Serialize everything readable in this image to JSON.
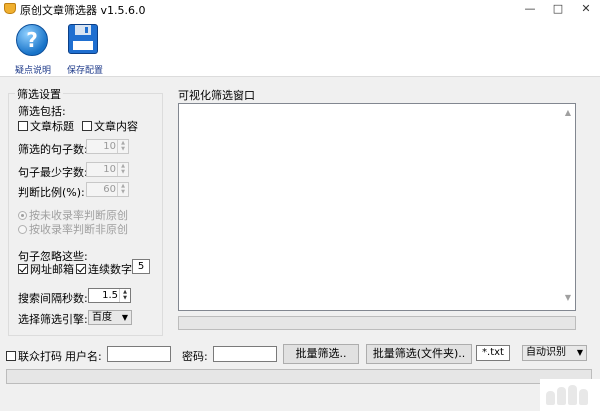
{
  "window": {
    "title": "原创文章筛选器 v1.5.6.0",
    "minimize": "—",
    "maximize": "□",
    "close": "✕"
  },
  "toolbar": {
    "help_label": "疑点说明",
    "save_label": "保存配置",
    "help_glyph": "?"
  },
  "settings": {
    "title": "筛选设置",
    "filter_include": "筛选包括:",
    "article_title": "文章标题",
    "article_content": "文章内容",
    "sentence_count_label": "筛选的句子数:",
    "sentence_count": "10",
    "min_chars_label": "句子最少字数:",
    "min_chars": "10",
    "ratio_label": "判断比例(%):",
    "ratio": "60",
    "radio_unindexed": "按未收录率判断原创",
    "radio_indexed": "按收录率判断非原创",
    "ignore_label": "句子忽略这些:",
    "url_email": "网址邮箱",
    "consecutive_digits": "连续数字",
    "consecutive_digits_value": "5",
    "interval_label": "搜索间隔秒数:",
    "interval": "1.5",
    "engine_label": "选择筛选引擎:",
    "engine": "百度"
  },
  "visual": {
    "title": "可视化筛选窗口"
  },
  "bottom": {
    "captcha": "联众打码",
    "username_label": "用户名:",
    "username": "",
    "password_label": "密码:",
    "password": "",
    "batch_button": "批量筛选..",
    "batch_folder_button": "批量筛选(文件夹)..",
    "ext_filter": "*.txt",
    "recognize": "自动识别"
  },
  "colors": {
    "toolbar_label": "#1e3a8a",
    "icon_blue": "#1873c8"
  }
}
